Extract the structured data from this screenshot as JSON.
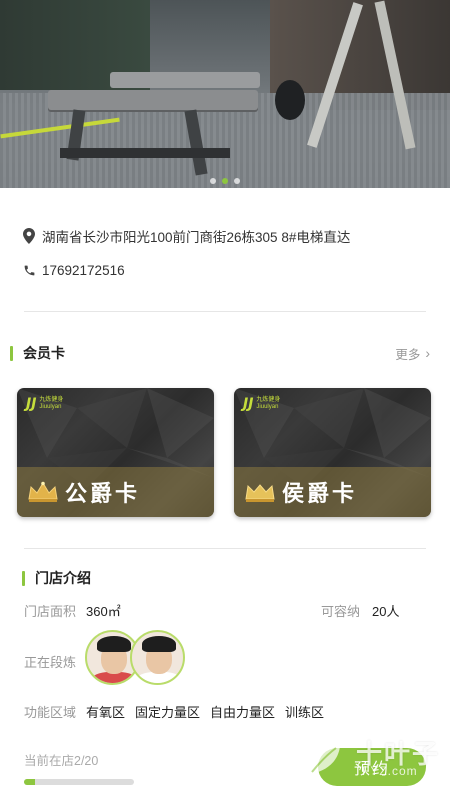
{
  "hero": {
    "slide_count": 3,
    "active_slide": 2
  },
  "info": {
    "address": "湖南省长沙市阳光100前门商街26栋305 8#电梯直达",
    "phone": "17692172516"
  },
  "membership": {
    "title": "会员卡",
    "more_label": "更多",
    "cards": [
      {
        "name": "公爵卡",
        "logo_mark": "JJ",
        "logo_text": "九炼健身",
        "logo_sub": "Jiuulyan",
        "crown": "crown-icon"
      },
      {
        "name": "侯爵卡",
        "logo_mark": "JJ",
        "logo_text": "九炼健身",
        "logo_sub": "Jiuulyan",
        "crown": "crown-icon"
      }
    ]
  },
  "store": {
    "title": "门店介绍",
    "area_label": "门店面积",
    "area_value": "360㎡",
    "capacity_label": "可容纳",
    "capacity_value": "20人",
    "training_label": "正在段炼",
    "function_label": "功能区域",
    "function_areas": [
      "有氧区",
      "固定力量区",
      "自由力量区",
      "训练区"
    ],
    "current_label": "当前在店2/20",
    "current_fraction": 0.1
  },
  "actions": {
    "book_label": "预约"
  },
  "watermark": {
    "text": "十叶子",
    "url": "FYZ.com"
  },
  "colors": {
    "accent": "#8dc63f"
  }
}
